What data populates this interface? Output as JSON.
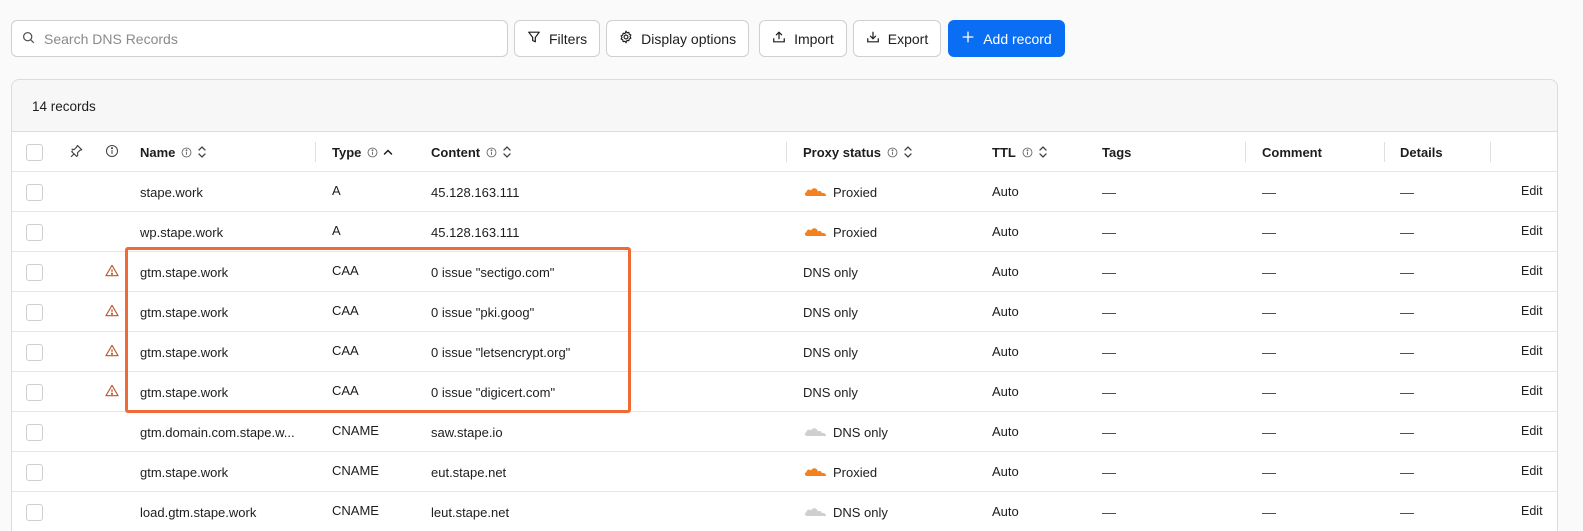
{
  "toolbar": {
    "search_placeholder": "Search DNS Records",
    "filters_label": "Filters",
    "display_options_label": "Display options",
    "import_label": "Import",
    "export_label": "Export",
    "add_record_label": "Add record"
  },
  "table": {
    "records_count": "14 records",
    "headers": {
      "name": "Name",
      "type": "Type",
      "content": "Content",
      "proxy_status": "Proxy status",
      "ttl": "TTL",
      "tags": "Tags",
      "comment": "Comment",
      "details": "Details"
    },
    "dash": "—",
    "edit_label": "Edit",
    "rows": [
      {
        "name": "stape.work",
        "type": "A",
        "content": "45.128.163.111",
        "proxy": "Proxied",
        "ttl": "Auto",
        "warning": false,
        "cloud": "orange"
      },
      {
        "name": "wp.stape.work",
        "type": "A",
        "content": "45.128.163.111",
        "proxy": "Proxied",
        "ttl": "Auto",
        "warning": false,
        "cloud": "orange"
      },
      {
        "name": "gtm.stape.work",
        "type": "CAA",
        "content": "0 issue \"sectigo.com\"",
        "proxy": "DNS only",
        "ttl": "Auto",
        "warning": true,
        "cloud": "none"
      },
      {
        "name": "gtm.stape.work",
        "type": "CAA",
        "content": "0 issue \"pki.goog\"",
        "proxy": "DNS only",
        "ttl": "Auto",
        "warning": true,
        "cloud": "none"
      },
      {
        "name": "gtm.stape.work",
        "type": "CAA",
        "content": "0 issue \"letsencrypt.org\"",
        "proxy": "DNS only",
        "ttl": "Auto",
        "warning": true,
        "cloud": "none"
      },
      {
        "name": "gtm.stape.work",
        "type": "CAA",
        "content": "0 issue \"digicert.com\"",
        "proxy": "DNS only",
        "ttl": "Auto",
        "warning": true,
        "cloud": "none"
      },
      {
        "name": "gtm.domain.com.stape.w...",
        "type": "CNAME",
        "content": "saw.stape.io",
        "proxy": "DNS only",
        "ttl": "Auto",
        "warning": false,
        "cloud": "gray"
      },
      {
        "name": "gtm.stape.work",
        "type": "CNAME",
        "content": "eut.stape.net",
        "proxy": "Proxied",
        "ttl": "Auto",
        "warning": false,
        "cloud": "orange"
      },
      {
        "name": "load.gtm.stape.work",
        "type": "CNAME",
        "content": "leut.stape.net",
        "proxy": "DNS only",
        "ttl": "Auto",
        "warning": false,
        "cloud": "gray"
      }
    ]
  },
  "colors": {
    "accent": "#0a6ef5",
    "highlight": "#f06a35",
    "proxied_cloud": "#f48120",
    "dns_only_cloud": "#cfcfcf",
    "warning": "#c0572b"
  }
}
